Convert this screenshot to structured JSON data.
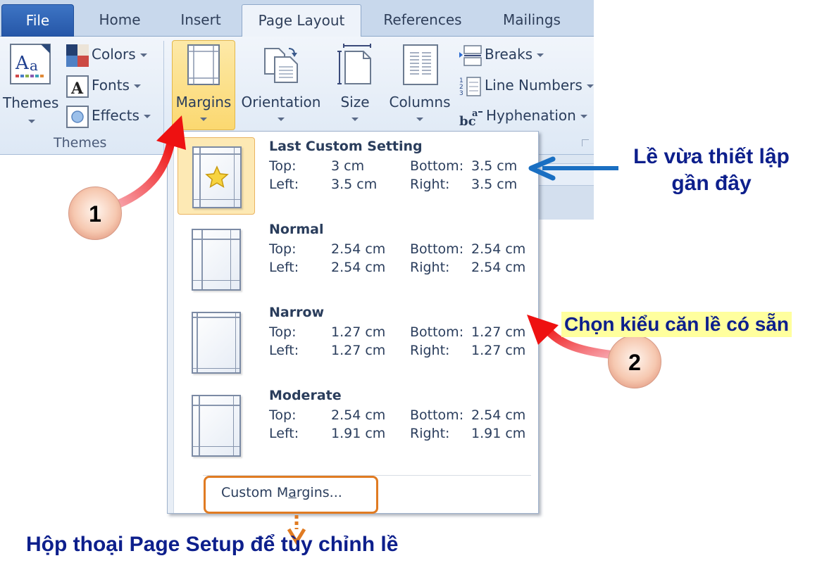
{
  "tabs": [
    {
      "label": "File"
    },
    {
      "label": "Home"
    },
    {
      "label": "Insert"
    },
    {
      "label": "Page Layout",
      "active": true
    },
    {
      "label": "References"
    },
    {
      "label": "Mailings"
    }
  ],
  "ribbon": {
    "themes_group": {
      "label": "Themes",
      "themes_button": "Themes",
      "colors": "Colors",
      "fonts": "Fonts",
      "effects": "Effects"
    },
    "page_setup": {
      "margins": "Margins",
      "orientation": "Orientation",
      "size": "Size",
      "columns": "Columns",
      "breaks": "Breaks",
      "line_numbers": "Line Numbers",
      "hyphenation": "Hyphenation"
    }
  },
  "margins_menu": {
    "options": [
      {
        "title": "Last Custom Setting",
        "top_label": "Top:",
        "top": "3 cm",
        "bottom_label": "Bottom:",
        "bottom": "3.5 cm",
        "left_label": "Left:",
        "left": "3.5 cm",
        "right_label": "Right:",
        "right": "3.5 cm",
        "selected": true
      },
      {
        "title": "Normal",
        "top_label": "Top:",
        "top": "2.54 cm",
        "bottom_label": "Bottom:",
        "bottom": "2.54 cm",
        "left_label": "Left:",
        "left": "2.54 cm",
        "right_label": "Right:",
        "right": "2.54 cm"
      },
      {
        "title": "Narrow",
        "top_label": "Top:",
        "top": "1.27 cm",
        "bottom_label": "Bottom:",
        "bottom": "1.27 cm",
        "left_label": "Left:",
        "left": "1.27 cm",
        "right_label": "Right:",
        "right": "1.27 cm"
      },
      {
        "title": "Moderate",
        "top_label": "Top:",
        "top": "2.54 cm",
        "bottom_label": "Bottom:",
        "bottom": "2.54 cm",
        "left_label": "Left:",
        "left": "1.91 cm",
        "right_label": "Right:",
        "right": "1.91 cm"
      }
    ],
    "custom_margins_pre": "Custom M",
    "custom_margins_u": "a",
    "custom_margins_post": "rgins..."
  },
  "annotations": {
    "recent_margin_line1": "Lề vừa thiết lập",
    "recent_margin_line2": "gần đây",
    "choose_preset": "Chọn  kiểu căn lề có sẵn",
    "page_setup_dialog": "Hộp thoại Page Setup để tùy chỉnh lề",
    "badge_1": "1",
    "badge_2": "2"
  },
  "colors": {
    "annotation_text": "#0d1f8c",
    "highlight_yellow": "#ffff9e",
    "orange_box": "#e07b22",
    "red_arrow": "#ee1111",
    "blue_arrow": "#1a6fc2"
  }
}
